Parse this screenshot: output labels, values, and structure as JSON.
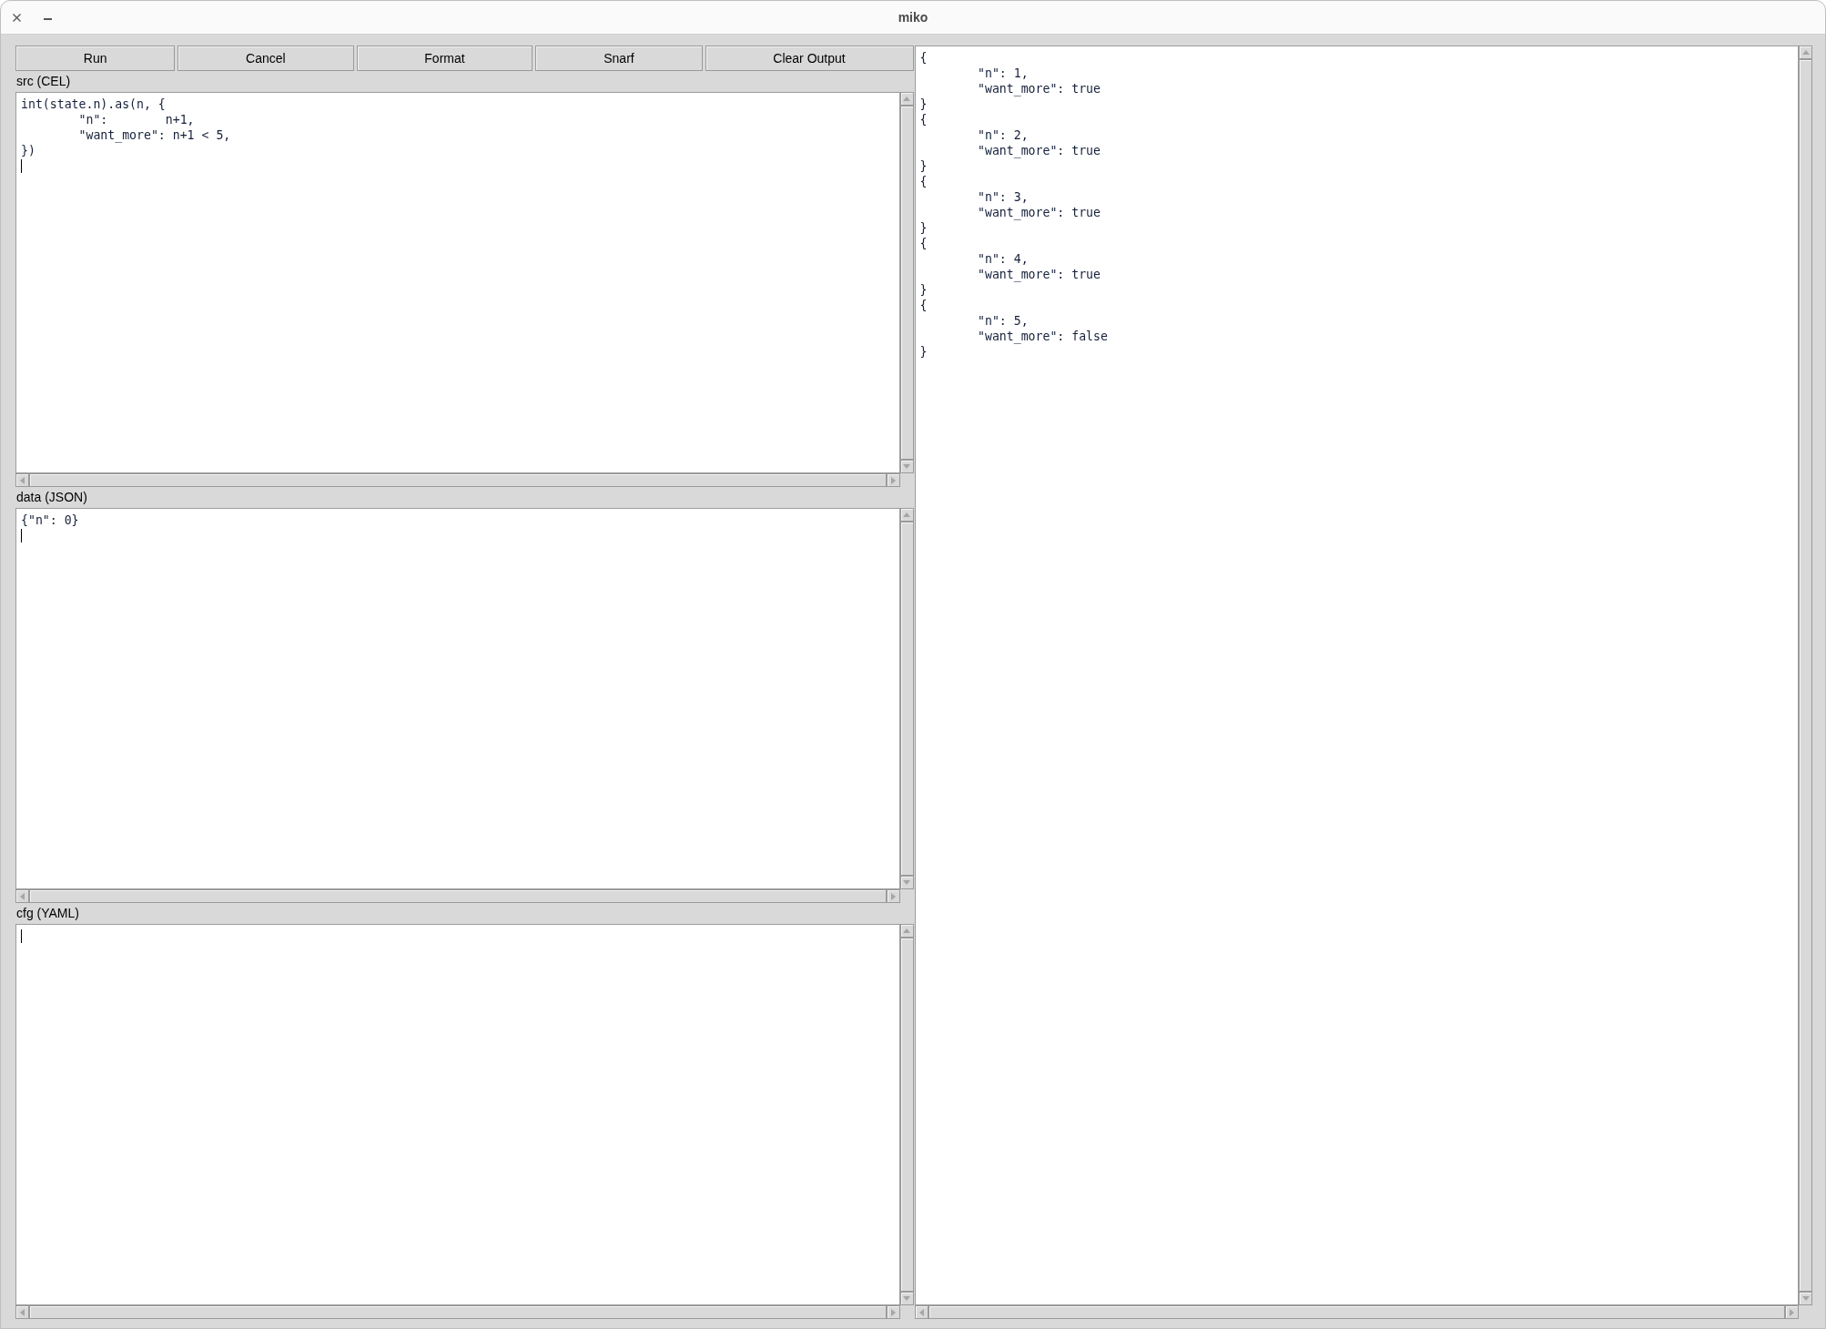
{
  "window": {
    "title": "miko"
  },
  "toolbar": {
    "buttons": [
      "Run",
      "Cancel",
      "Format",
      "Snarf",
      "Clear Output"
    ]
  },
  "editors": [
    {
      "label": "src (CEL)",
      "value": "int(state.n).as(n, {\n\t\"n\":        n+1,\n\t\"want_more\": n+1 < 5,\n})",
      "caret": true
    },
    {
      "label": "data (JSON)",
      "value": "{\"n\": 0}",
      "caret": true
    },
    {
      "label": "cfg (YAML)",
      "caret": true
    }
  ],
  "output": {
    "records": [
      "{\n\t\"n\": 1,\n\t\"want_more\": true\n}",
      "{\n\t\"n\": 2,\n\t\"want_more\": true\n}",
      "{\n\t\"n\": 3,\n\t\"want_more\": true\n}",
      "{\n\t\"n\": 4,\n\t\"want_more\": true\n}",
      "{\n\t\"n\": 5,\n\t\"want_more\": false\n}"
    ]
  }
}
